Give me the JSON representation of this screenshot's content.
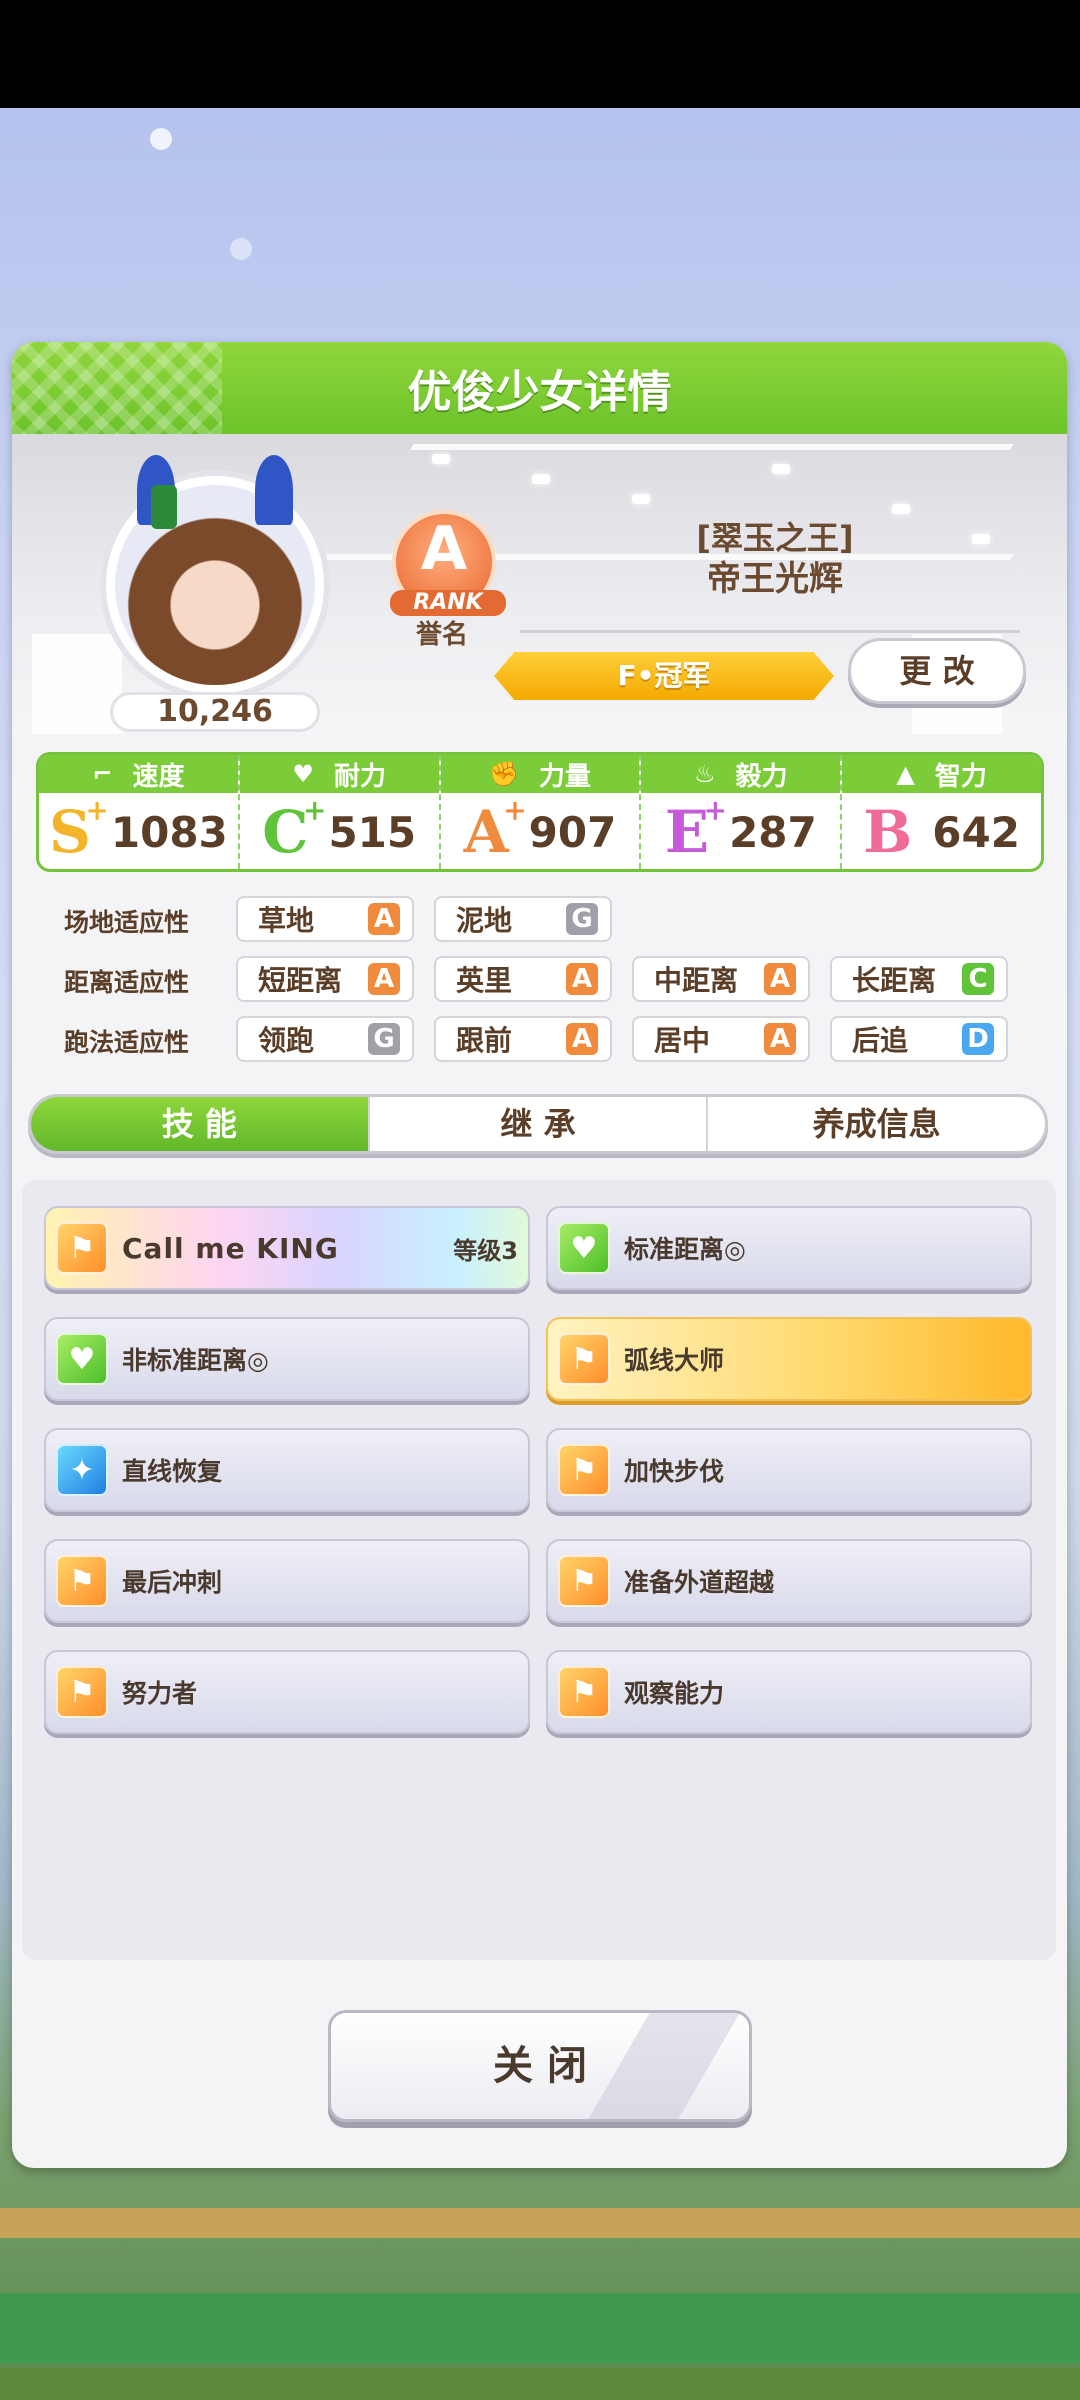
{
  "header": {
    "title": "优俊少女详情"
  },
  "profile": {
    "fans": "10,246",
    "rank_letter": "A",
    "rank_text": "RANK",
    "honor_label": "誉名",
    "epithet": "[翠玉之王]",
    "name": "帝王光辉",
    "title_banner": "F•冠军",
    "change_label": "更 改"
  },
  "stats": [
    {
      "label": "速度",
      "icon": "shoe-icon",
      "grade": "S",
      "plus": "+",
      "value": "1083",
      "color": "#f2b52a"
    },
    {
      "label": "耐力",
      "icon": "heart-icon",
      "grade": "C",
      "plus": "+",
      "value": "515",
      "color": "#5fc43a"
    },
    {
      "label": "力量",
      "icon": "arm-icon",
      "grade": "A",
      "plus": "+",
      "value": "907",
      "color": "#f08a3c"
    },
    {
      "label": "毅力",
      "icon": "flame-icon",
      "grade": "E",
      "plus": "+",
      "value": "287",
      "color": "#c65ad8"
    },
    {
      "label": "智力",
      "icon": "graduation-cap-icon",
      "grade": "B",
      "plus": "",
      "value": "642",
      "color": "#f06a9a"
    }
  ],
  "aptitude": {
    "track_label": "场地适应性",
    "distance_label": "距离适应性",
    "style_label": "跑法适应性",
    "track": [
      {
        "name": "草地",
        "grade": "A",
        "color": "#f08a3c"
      },
      {
        "name": "泥地",
        "grade": "G",
        "color": "#a0a0a8"
      }
    ],
    "distance": [
      {
        "name": "短距离",
        "grade": "A",
        "color": "#f08a3c"
      },
      {
        "name": "英里",
        "grade": "A",
        "color": "#f08a3c"
      },
      {
        "name": "中距离",
        "grade": "A",
        "color": "#f08a3c"
      },
      {
        "name": "长距离",
        "grade": "C",
        "color": "#5fc43a"
      }
    ],
    "style": [
      {
        "name": "领跑",
        "grade": "G",
        "color": "#a0a0a8"
      },
      {
        "name": "跟前",
        "grade": "A",
        "color": "#f08a3c"
      },
      {
        "name": "居中",
        "grade": "A",
        "color": "#f08a3c"
      },
      {
        "name": "后追",
        "grade": "D",
        "color": "#4aa8f0"
      }
    ]
  },
  "tabs": [
    "技 能",
    "继 承",
    "养成信息"
  ],
  "skills": [
    {
      "name": "Call me KING",
      "level": "等级3",
      "icon_type": "orange",
      "icon": "runner-icon"
    },
    {
      "name": "标准距离◎",
      "level": "",
      "icon_type": "green",
      "icon": "heart-icon"
    },
    {
      "name": "非标准距离◎",
      "level": "",
      "icon_type": "green",
      "icon": "heart-icon"
    },
    {
      "name": "弧线大师",
      "level": "",
      "icon_type": "orange",
      "icon": "runner-icon"
    },
    {
      "name": "直线恢复",
      "level": "",
      "icon_type": "blue",
      "icon": "sparkle-icon"
    },
    {
      "name": "加快步伐",
      "level": "",
      "icon_type": "orange",
      "icon": "runner-icon"
    },
    {
      "name": "最后冲刺",
      "level": "",
      "icon_type": "orange",
      "icon": "runner-icon"
    },
    {
      "name": "准备外道超越",
      "level": "",
      "icon_type": "orange",
      "icon": "runner-icon"
    },
    {
      "name": "努力者",
      "level": "",
      "icon_type": "orange",
      "icon": "runner-icon"
    },
    {
      "name": "观察能力",
      "level": "",
      "icon_type": "orange",
      "icon": "megaphone-icon"
    }
  ],
  "close_label": "关 闭"
}
